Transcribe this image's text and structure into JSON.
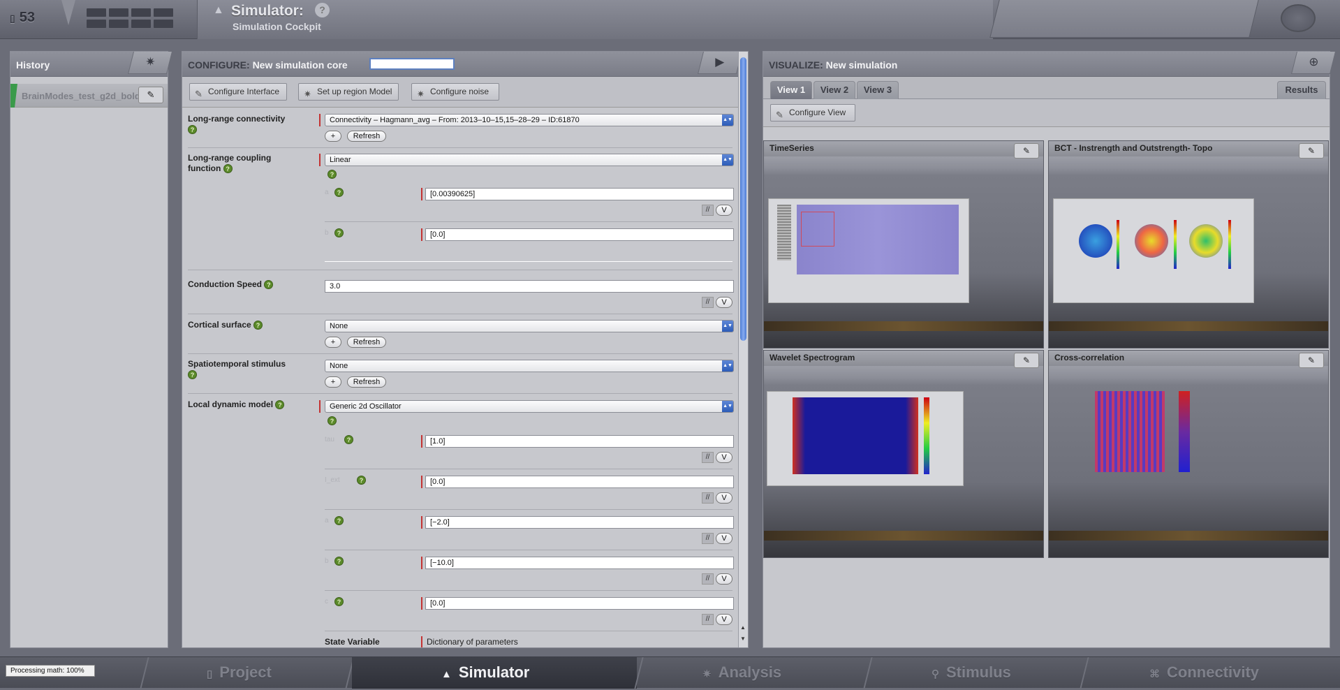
{
  "header": {
    "project_count": "53",
    "title": "Simulator:",
    "help": "?",
    "subtitle": "Simulation Cockpit"
  },
  "history": {
    "title": "History",
    "items": [
      {
        "name": "BrainModes_test_g2d_bold"
      }
    ]
  },
  "configure": {
    "label": "CONFIGURE:",
    "sim_name": "New simulation core",
    "toolbar": {
      "configure_interface": "Configure Interface",
      "setup_region_model": "Set up region Model",
      "configure_noise": "Configure noise"
    },
    "fields": {
      "connectivity": {
        "label": "Long-range connectivity",
        "value": "Connectivity – Hagmann_avg – From: 2013–10–15,15–28–29 – ID:61870",
        "add": "+",
        "refresh": "Refresh"
      },
      "coupling": {
        "label": "Long-range coupling function",
        "value": "Linear",
        "params": [
          "[0.00390625]",
          "[0.0]"
        ]
      },
      "conduction_speed": {
        "label": "Conduction Speed",
        "value": "3.0"
      },
      "cortical_surface": {
        "label": "Cortical surface",
        "value": "None",
        "add": "+",
        "refresh": "Refresh"
      },
      "stimulus": {
        "label": "Spatiotemporal stimulus",
        "value": "None",
        "add": "+",
        "refresh": "Refresh"
      },
      "model": {
        "label": "Local dynamic model",
        "value": "Generic 2d Oscillator",
        "params": [
          "[1.0]",
          "[0.0]",
          "[−2.0]",
          "[−10.0]",
          "[0.0]"
        ]
      },
      "state_variable": {
        "label": "State Variable",
        "value": "Dictionary of parameters"
      }
    },
    "slash_btn": "//",
    "v_btn": "V"
  },
  "visualize": {
    "label": "VISUALIZE:",
    "sim_name": "New simulation",
    "tabs": [
      "View 1",
      "View 2",
      "View 3"
    ],
    "results_tab": "Results",
    "configure_view": "Configure View",
    "viewers": [
      {
        "title": "TimeSeries"
      },
      {
        "title": "BCT - Instrength and Outstrength- Topo"
      },
      {
        "title": "Wavelet Spectrogram"
      },
      {
        "title": "Cross-correlation"
      }
    ]
  },
  "bottom": {
    "processing": "Processing math: 100%",
    "tabs": [
      "Project",
      "Simulator",
      "Analysis",
      "Stimulus",
      "Connectivity"
    ]
  },
  "colors": {
    "accent": "#4c7bd2",
    "required_mark": "#c43333",
    "help_green": "#5b8a2a",
    "history_status": "#3a9a4a"
  },
  "icons": {
    "history_corner": "gear-icon",
    "launch": "play-icon",
    "visualize_corner": "zoom-icon",
    "edit": "pencil-icon"
  }
}
